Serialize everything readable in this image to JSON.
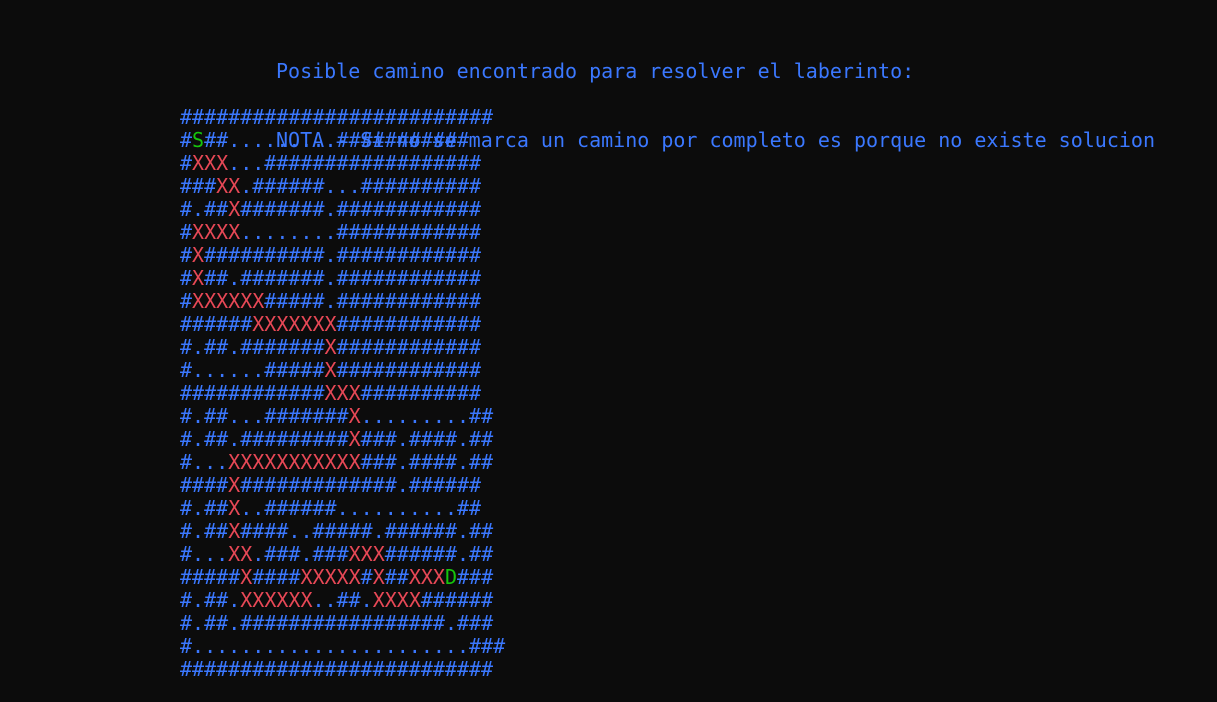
{
  "terminal": {
    "line1": "Posible camino encontrado para resolver el laberinto:",
    "line2": "NOTA - Si no se marca un camino por completo es porque no existe solucion"
  },
  "colors": {
    "wall": "#3b78ff",
    "open": "#3b78ff",
    "path": "#e74856",
    "start": "#16c60c",
    "end": "#16c60c",
    "background": "#0c0c0c"
  },
  "maze": {
    "rows": [
      "##########################",
      "#S##.........###########",
      "#XXX...##################",
      "###XX.######...##########",
      "#.##X#######.############",
      "#XXXX........############",
      "#X##########.############",
      "#X##.#######.############",
      "#XXXXXX#####.############",
      "######XXXXXXX############",
      "#.##.#######X############",
      "#......#####X############",
      "############XXX##########",
      "#.##...#######X.........##",
      "#.##.#########X###.####.##",
      "#...XXXXXXXXXXX###.####.##",
      "####X#############.######",
      "#.##X..######..........##",
      "#.##X####..#####.######.##",
      "#...XX.###.###XXX######.##",
      "#####X####XXXXX#X##XXXD###",
      "#.##.XXXXXX..##.XXXX######",
      "#.##.#################.###",
      "#.......................###",
      "##########################"
    ]
  }
}
